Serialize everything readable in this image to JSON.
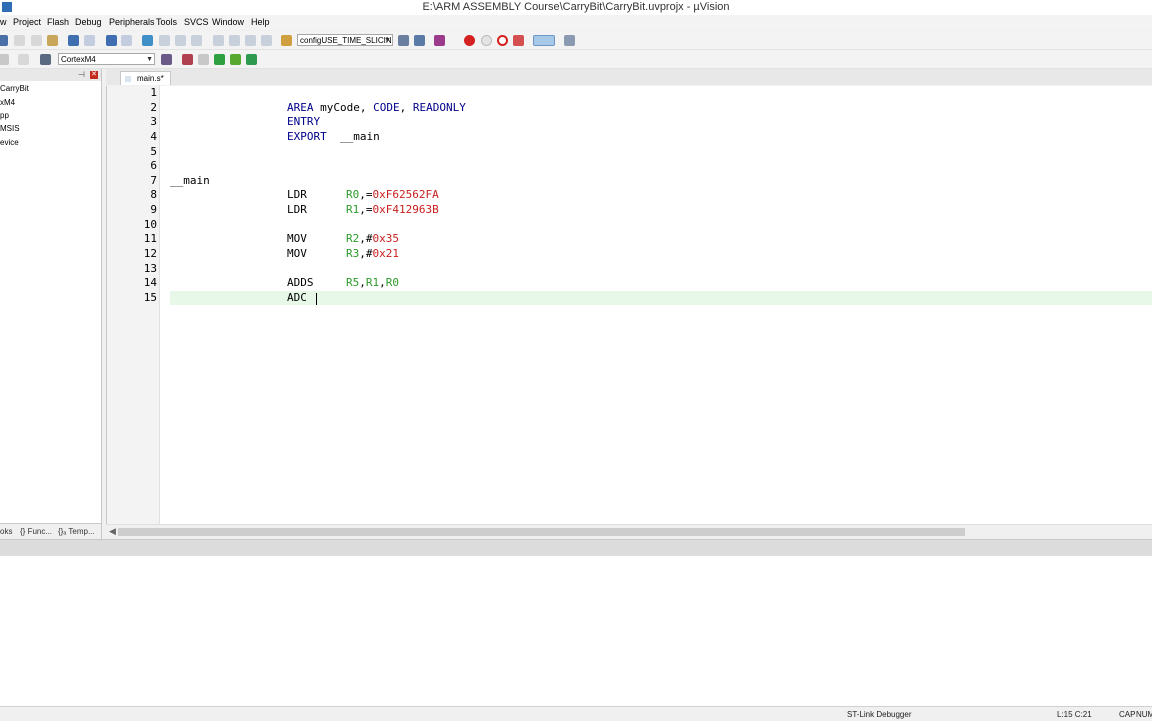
{
  "window": {
    "title": "E:\\ARM ASSEMBLY Course\\CarryBit\\CarryBit.uvprojx - µVision"
  },
  "menu": [
    "Project",
    "Flash",
    "Debug",
    "Peripherals",
    "Tools",
    "SVCS",
    "Window",
    "Help"
  ],
  "menu_partial": "w",
  "toolbar": {
    "target_combo": "configUSE_TIME_SLICING",
    "device_combo": "CortexM4"
  },
  "project_tree": [
    "CarryBit",
    "xM4",
    "pp",
    "MSIS",
    "evice"
  ],
  "panel_tabs": [
    "oks",
    "{} Func...",
    "{}ₐ Temp..."
  ],
  "editor_tab": {
    "label": "main.s*"
  },
  "line_numbers": [
    "1",
    "2",
    "3",
    "4",
    "5",
    "6",
    "7",
    "8",
    "9",
    "10",
    "11",
    "12",
    "13",
    "14",
    "15"
  ],
  "code": {
    "l2": {
      "op": "AREA",
      "rest_a": " myCode, ",
      "rest_b": "CODE",
      "rest_c": ", ",
      "rest_d": "READONLY"
    },
    "l3": {
      "op": "ENTRY"
    },
    "l4": {
      "op": "EXPORT",
      "rest": "  __main"
    },
    "l7": {
      "label": "__main"
    },
    "l8": {
      "op": "LDR",
      "reg": "R0",
      "sep": ",=",
      "val": "0xF62562FA"
    },
    "l9": {
      "op": "LDR",
      "reg": "R1",
      "sep": ",=",
      "val": "0xF412963B"
    },
    "l11": {
      "op": "MOV",
      "reg": "R2",
      "sep": ",#",
      "val": "0x35"
    },
    "l12": {
      "op": "MOV",
      "reg": "R3",
      "sep": ",#",
      "val": "0x21"
    },
    "l14": {
      "op": "ADDS",
      "r1": "R5",
      "c1": ",",
      "r2": "R1",
      "c2": ",",
      "r3": "R0"
    },
    "l15": {
      "op": "ADC"
    }
  },
  "status": {
    "debugger": "ST-Link Debugger",
    "position": "L:15 C:21",
    "caps": "CAP",
    "num": "NUM"
  },
  "colors": {
    "keyword": "#00008b",
    "register": "#2c9a2c",
    "number": "#c81e1e",
    "current_line": "#e8f8e8"
  }
}
